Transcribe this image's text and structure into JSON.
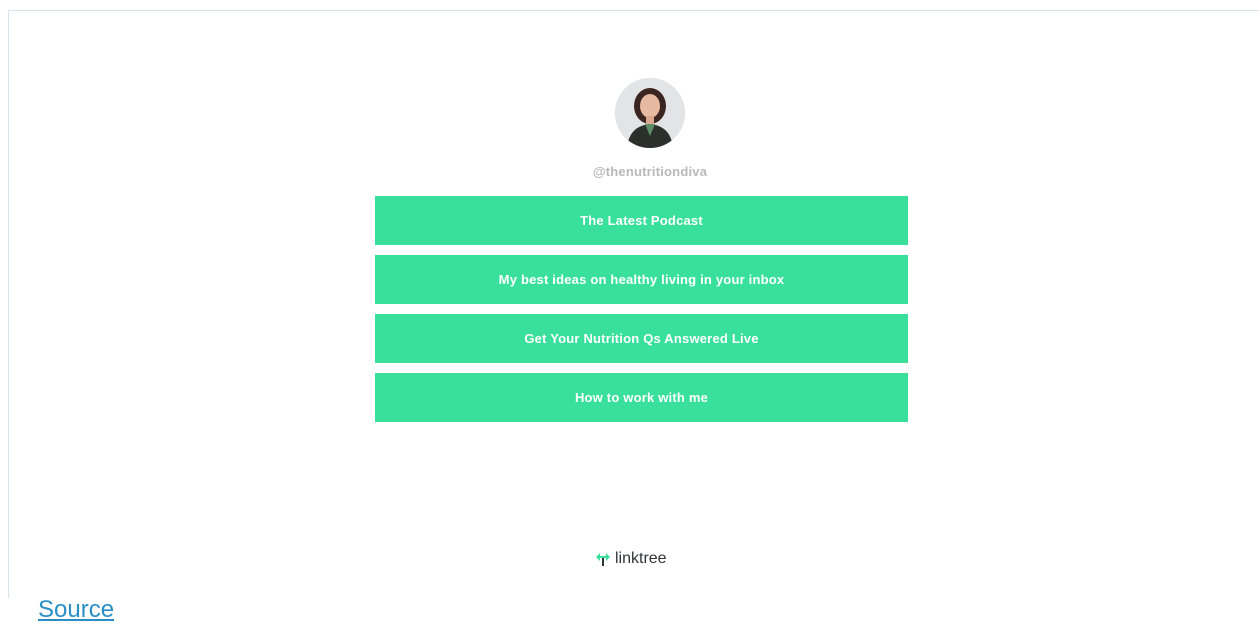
{
  "profile": {
    "handle": "@thenutritiondiva",
    "avatar_icon": "profile-photo"
  },
  "links": [
    {
      "label": "The Latest Podcast"
    },
    {
      "label": "My best ideas on healthy living in your inbox"
    },
    {
      "label": "Get Your Nutrition Qs Answered Live"
    },
    {
      "label": "How to work with me"
    }
  ],
  "footer": {
    "logo_text": "linktree",
    "logo_icon": "linktree-icon"
  },
  "source": {
    "label": "Source"
  },
  "colors": {
    "button_bg": "#39e09b",
    "button_text": "#ffffff",
    "handle_text": "#b9b9b9",
    "logo_green": "#39e09b",
    "source_link": "#2a8fc7"
  }
}
